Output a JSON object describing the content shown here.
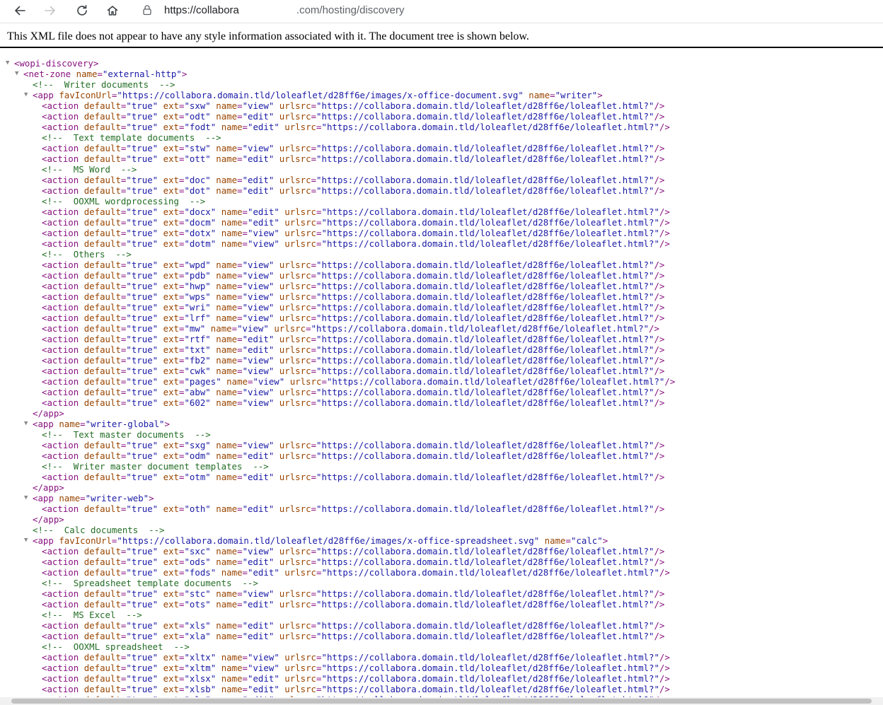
{
  "toolbar": {
    "back_icon": "arrow-left-icon",
    "forward_icon": "arrow-right-icon",
    "refresh_icon": "refresh-icon",
    "home_icon": "home-icon",
    "lock_icon": "lock-icon",
    "url_scheme_host": "https://collabora",
    "url_rest": ".com/hosting/discovery"
  },
  "info_text": "This XML file does not appear to have any style information associated with it. The document tree is shown below.",
  "colors": {
    "tag": "#881280",
    "attribute": "#994500",
    "value": "#1a1aa6",
    "comment": "#236e25"
  },
  "xml": {
    "root": "wopi-discovery",
    "net_zone": "external-http",
    "writer_icon": "https://collabora.domain.tld/loleaflet/d28ff6e/images/x-office-document.svg",
    "calc_icon": "https://collabora.domain.tld/loleaflet/d28ff6e/images/x-office-spreadsheet.svg",
    "action_url": "https://collabora.domain.tld/loleaflet/d28ff6e/loleaflet.html?",
    "nodes": [
      {
        "k": "open",
        "d": 0,
        "tag": "wopi-discovery",
        "attrs": []
      },
      {
        "k": "open",
        "d": 1,
        "tag": "net-zone",
        "attrs": [
          [
            "name",
            "external-http"
          ]
        ]
      },
      {
        "k": "comment",
        "d": 2,
        "text": "Writer documents"
      },
      {
        "k": "open",
        "d": 2,
        "tag": "app",
        "attrs": [
          [
            "favIconUrl",
            "https://collabora.domain.tld/loleaflet/d28ff6e/images/x-office-document.svg"
          ],
          [
            "name",
            "writer"
          ]
        ]
      },
      {
        "k": "action",
        "d": 3,
        "ext": "sxw",
        "name": "view"
      },
      {
        "k": "action",
        "d": 3,
        "ext": "odt",
        "name": "edit"
      },
      {
        "k": "action",
        "d": 3,
        "ext": "fodt",
        "name": "edit"
      },
      {
        "k": "comment",
        "d": 3,
        "text": "Text template documents"
      },
      {
        "k": "action",
        "d": 3,
        "ext": "stw",
        "name": "view"
      },
      {
        "k": "action",
        "d": 3,
        "ext": "ott",
        "name": "edit"
      },
      {
        "k": "comment",
        "d": 3,
        "text": "MS Word"
      },
      {
        "k": "action",
        "d": 3,
        "ext": "doc",
        "name": "edit"
      },
      {
        "k": "action",
        "d": 3,
        "ext": "dot",
        "name": "edit"
      },
      {
        "k": "comment",
        "d": 3,
        "text": "OOXML wordprocessing"
      },
      {
        "k": "action",
        "d": 3,
        "ext": "docx",
        "name": "edit"
      },
      {
        "k": "action",
        "d": 3,
        "ext": "docm",
        "name": "edit"
      },
      {
        "k": "action",
        "d": 3,
        "ext": "dotx",
        "name": "view"
      },
      {
        "k": "action",
        "d": 3,
        "ext": "dotm",
        "name": "view"
      },
      {
        "k": "comment",
        "d": 3,
        "text": "Others"
      },
      {
        "k": "action",
        "d": 3,
        "ext": "wpd",
        "name": "view"
      },
      {
        "k": "action",
        "d": 3,
        "ext": "pdb",
        "name": "view"
      },
      {
        "k": "action",
        "d": 3,
        "ext": "hwp",
        "name": "view"
      },
      {
        "k": "action",
        "d": 3,
        "ext": "wps",
        "name": "view"
      },
      {
        "k": "action",
        "d": 3,
        "ext": "wri",
        "name": "view"
      },
      {
        "k": "action",
        "d": 3,
        "ext": "lrf",
        "name": "view"
      },
      {
        "k": "action",
        "d": 3,
        "ext": "mw",
        "name": "view"
      },
      {
        "k": "action",
        "d": 3,
        "ext": "rtf",
        "name": "edit"
      },
      {
        "k": "action",
        "d": 3,
        "ext": "txt",
        "name": "edit"
      },
      {
        "k": "action",
        "d": 3,
        "ext": "fb2",
        "name": "view"
      },
      {
        "k": "action",
        "d": 3,
        "ext": "cwk",
        "name": "view"
      },
      {
        "k": "action",
        "d": 3,
        "ext": "pages",
        "name": "view"
      },
      {
        "k": "action",
        "d": 3,
        "ext": "abw",
        "name": "view"
      },
      {
        "k": "action",
        "d": 3,
        "ext": "602",
        "name": "view"
      },
      {
        "k": "close",
        "d": 2,
        "tag": "app"
      },
      {
        "k": "open",
        "d": 2,
        "tag": "app",
        "attrs": [
          [
            "name",
            "writer-global"
          ]
        ]
      },
      {
        "k": "comment",
        "d": 3,
        "text": "Text master documents"
      },
      {
        "k": "action",
        "d": 3,
        "ext": "sxg",
        "name": "view"
      },
      {
        "k": "action",
        "d": 3,
        "ext": "odm",
        "name": "edit"
      },
      {
        "k": "comment",
        "d": 3,
        "text": "Writer master document templates"
      },
      {
        "k": "action",
        "d": 3,
        "ext": "otm",
        "name": "edit"
      },
      {
        "k": "close",
        "d": 2,
        "tag": "app"
      },
      {
        "k": "open",
        "d": 2,
        "tag": "app",
        "attrs": [
          [
            "name",
            "writer-web"
          ]
        ]
      },
      {
        "k": "action",
        "d": 3,
        "ext": "oth",
        "name": "edit"
      },
      {
        "k": "close",
        "d": 2,
        "tag": "app"
      },
      {
        "k": "comment",
        "d": 2,
        "text": "Calc documents"
      },
      {
        "k": "open",
        "d": 2,
        "tag": "app",
        "attrs": [
          [
            "favIconUrl",
            "https://collabora.domain.tld/loleaflet/d28ff6e/images/x-office-spreadsheet.svg"
          ],
          [
            "name",
            "calc"
          ]
        ]
      },
      {
        "k": "action",
        "d": 3,
        "ext": "sxc",
        "name": "view"
      },
      {
        "k": "action",
        "d": 3,
        "ext": "ods",
        "name": "edit"
      },
      {
        "k": "action",
        "d": 3,
        "ext": "fods",
        "name": "edit"
      },
      {
        "k": "comment",
        "d": 3,
        "text": "Spreadsheet template documents"
      },
      {
        "k": "action",
        "d": 3,
        "ext": "stc",
        "name": "view"
      },
      {
        "k": "action",
        "d": 3,
        "ext": "ots",
        "name": "edit"
      },
      {
        "k": "comment",
        "d": 3,
        "text": "MS Excel"
      },
      {
        "k": "action",
        "d": 3,
        "ext": "xls",
        "name": "edit"
      },
      {
        "k": "action",
        "d": 3,
        "ext": "xla",
        "name": "edit"
      },
      {
        "k": "comment",
        "d": 3,
        "text": "OOXML spreadsheet"
      },
      {
        "k": "action",
        "d": 3,
        "ext": "xltx",
        "name": "view"
      },
      {
        "k": "action",
        "d": 3,
        "ext": "xltm",
        "name": "view"
      },
      {
        "k": "action",
        "d": 3,
        "ext": "xlsx",
        "name": "edit"
      },
      {
        "k": "action",
        "d": 3,
        "ext": "xlsb",
        "name": "edit"
      },
      {
        "k": "action",
        "d": 3,
        "ext": "xls",
        "name": "edit"
      }
    ]
  }
}
